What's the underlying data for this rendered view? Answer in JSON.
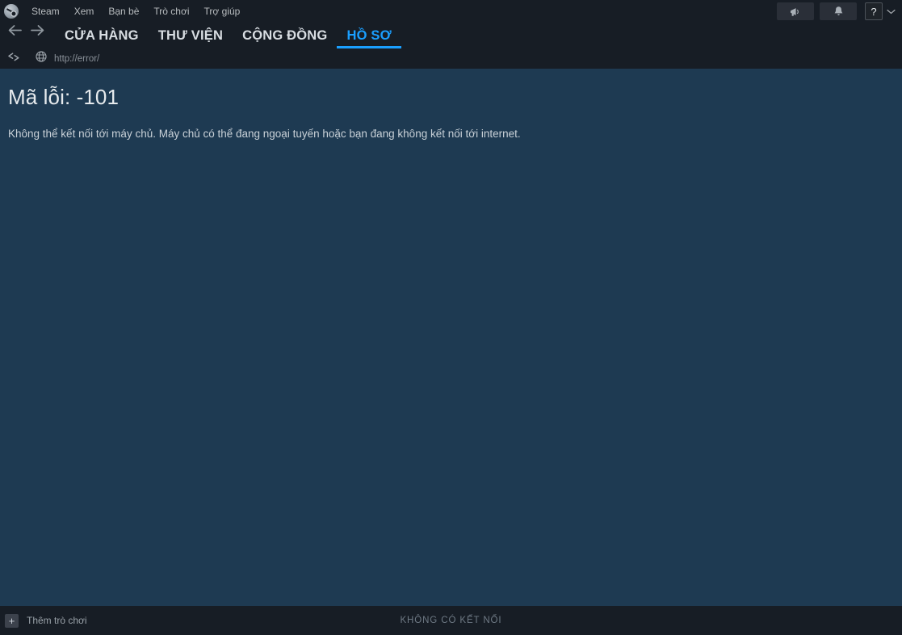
{
  "window": {
    "app_name": "Steam"
  },
  "menubar": {
    "logo_icon": "steam-logo-icon",
    "items": [
      {
        "label": "Steam"
      },
      {
        "label": "Xem"
      },
      {
        "label": "Bạn bè"
      },
      {
        "label": "Trò chơi"
      },
      {
        "label": "Trợ giúp"
      }
    ],
    "right_buttons": [
      {
        "name": "announcements-button",
        "icon": "megaphone-icon"
      },
      {
        "name": "notifications-button",
        "icon": "bell-icon"
      }
    ],
    "avatar": {
      "label": "?",
      "icon": "avatar-placeholder-icon"
    },
    "account_chevron_icon": "chevron-down-icon"
  },
  "nav": {
    "back_icon": "arrow-left-icon",
    "forward_icon": "arrow-right-icon",
    "tabs": [
      {
        "label": "CỬA HÀNG",
        "active": false
      },
      {
        "label": "THƯ VIỆN",
        "active": false
      },
      {
        "label": "CỘNG ĐỒNG",
        "active": false
      },
      {
        "label": "HỒ SƠ",
        "active": true
      }
    ],
    "active_color": "#1a9fff"
  },
  "urlbar": {
    "refresh_icon": "refresh-stop-icon",
    "site_icon": "globe-icon",
    "url": "http://error/"
  },
  "content": {
    "error_title": "Mã lỗi: -101",
    "error_message": "Không thể kết nối tới máy chủ. Máy chủ có thể đang ngoại tuyến hoặc bạn đang không kết nối tới internet.",
    "background_color": "#1e3a52"
  },
  "footer": {
    "add_game_icon": "plus-icon",
    "add_game_label": "Thêm trò chơi",
    "status_text": "KHÔNG CÓ KẾT NỐI"
  }
}
